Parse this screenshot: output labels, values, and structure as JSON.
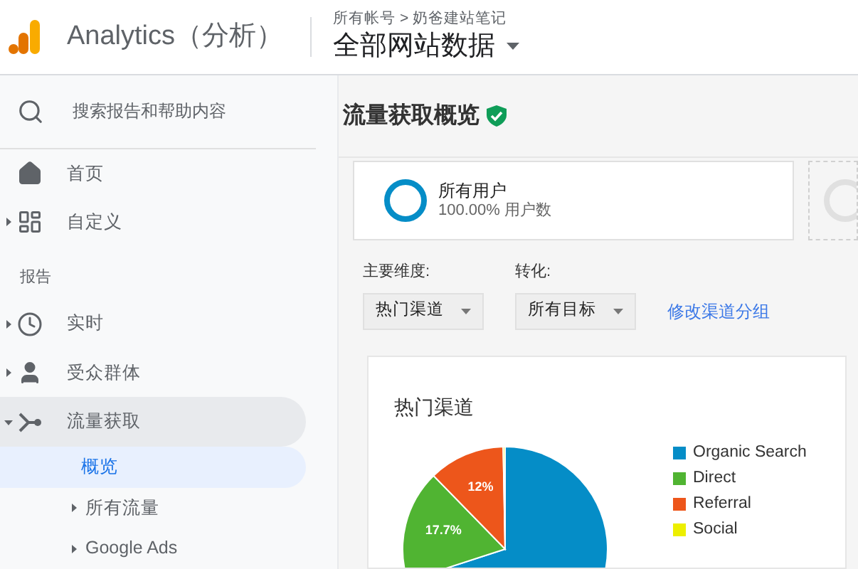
{
  "header": {
    "product": "Analytics（分析）",
    "breadcrumb": "所有帐号 > 奶爸建站笔记",
    "view": "全部网站数据"
  },
  "sidebar": {
    "search_placeholder": "搜索报告和帮助内容",
    "items": [
      {
        "kind": "item",
        "label": "首页",
        "selected": false
      },
      {
        "kind": "item",
        "label": "自定义",
        "expanded": false,
        "selected": false
      },
      {
        "kind": "section",
        "label": "报告"
      },
      {
        "kind": "item",
        "label": "实时",
        "expanded": false,
        "selected": false
      },
      {
        "kind": "item",
        "label": "受众群体",
        "expanded": false,
        "selected": false
      },
      {
        "kind": "item",
        "label": "流量获取",
        "expanded": true,
        "selected": false,
        "children": [
          {
            "label": "概览",
            "selected": true
          },
          {
            "label": "所有流量",
            "expanded": false,
            "selected": false
          },
          {
            "label": "Google Ads",
            "expanded": false,
            "selected": false
          }
        ]
      }
    ]
  },
  "page": {
    "title": "流量获取概览",
    "verified": true,
    "segment": {
      "name": "所有用户",
      "detail": "100.00% 用户数"
    },
    "filters": [
      {
        "label": "主要维度:",
        "value": "热门渠道"
      },
      {
        "label": "转化:",
        "value": "所有目标"
      }
    ],
    "link": "修改渠道分组",
    "chart_card": {
      "title": "热门渠道",
      "chart_data": {
        "type": "pie",
        "categories": [
          "Organic Search",
          "Direct",
          "Referral",
          "Social"
        ],
        "series": [
          {
            "values": [
              70.0,
              17.7,
              12.0,
              0.3
            ]
          }
        ],
        "legend": "right",
        "colors": [
          "#058dc7",
          "#50b432",
          "#ed561b",
          "#edef00"
        ],
        "value_labels": [
          null,
          "17.7%",
          "12%",
          null
        ]
      }
    }
  }
}
